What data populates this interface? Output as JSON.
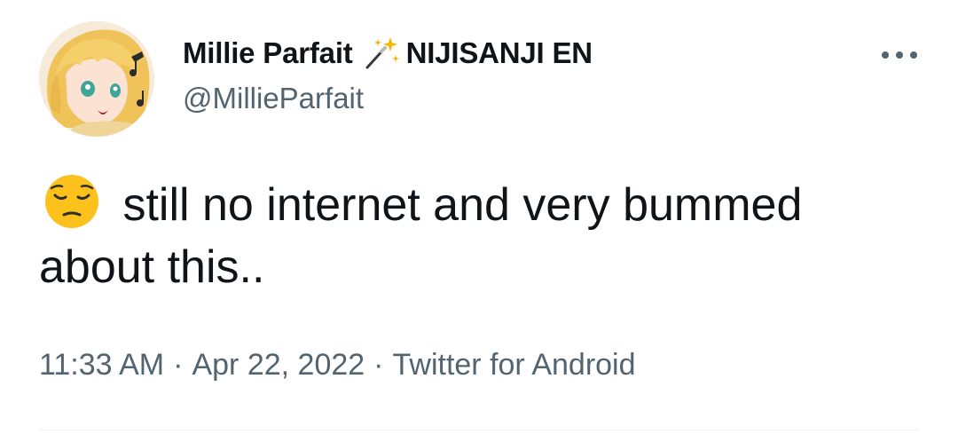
{
  "tweet": {
    "author": {
      "display_name": "Millie Parfait",
      "name_badge_icon": "magic-wand-sparkle-icon",
      "affiliation": "NIJISANJI EN",
      "handle": "@MillieParfait",
      "avatar_icon": "avatar-anime-character"
    },
    "more_icon": "more-options-icon",
    "emoji_icon": "pensive-face-emoji",
    "text": "still no internet and very bummed about this..",
    "meta": {
      "time": "11:33 AM",
      "separator": "·",
      "date": "Apr 22, 2022",
      "source": "Twitter for Android"
    }
  },
  "colors": {
    "text_primary": "#0f1419",
    "text_secondary": "#536471",
    "divider": "#eff3f4",
    "emoji_yellow": "#fcc21b",
    "avatar_hair": "#f2c94c"
  }
}
